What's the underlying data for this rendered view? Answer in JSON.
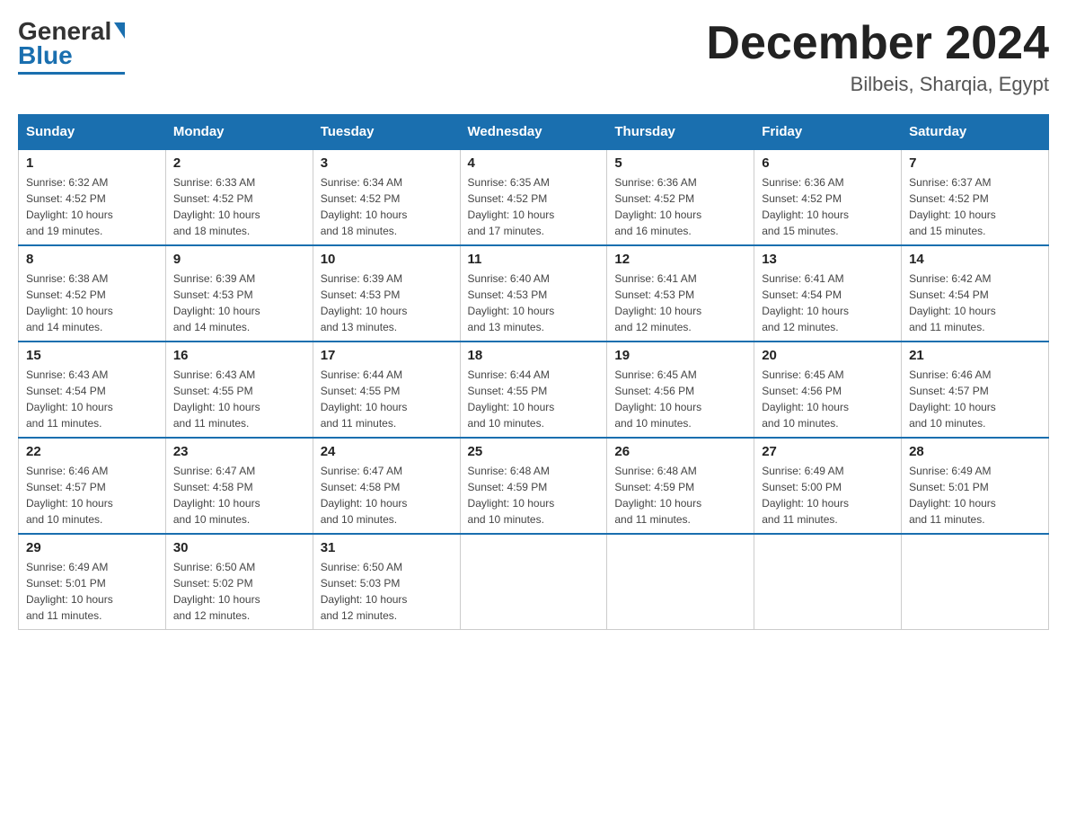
{
  "header": {
    "logo_general": "General",
    "logo_blue": "Blue",
    "month_title": "December 2024",
    "location": "Bilbeis, Sharqia, Egypt"
  },
  "days_of_week": [
    "Sunday",
    "Monday",
    "Tuesday",
    "Wednesday",
    "Thursday",
    "Friday",
    "Saturday"
  ],
  "weeks": [
    [
      {
        "num": "1",
        "sunrise": "6:32 AM",
        "sunset": "4:52 PM",
        "daylight": "10 hours and 19 minutes."
      },
      {
        "num": "2",
        "sunrise": "6:33 AM",
        "sunset": "4:52 PM",
        "daylight": "10 hours and 18 minutes."
      },
      {
        "num": "3",
        "sunrise": "6:34 AM",
        "sunset": "4:52 PM",
        "daylight": "10 hours and 18 minutes."
      },
      {
        "num": "4",
        "sunrise": "6:35 AM",
        "sunset": "4:52 PM",
        "daylight": "10 hours and 17 minutes."
      },
      {
        "num": "5",
        "sunrise": "6:36 AM",
        "sunset": "4:52 PM",
        "daylight": "10 hours and 16 minutes."
      },
      {
        "num": "6",
        "sunrise": "6:36 AM",
        "sunset": "4:52 PM",
        "daylight": "10 hours and 15 minutes."
      },
      {
        "num": "7",
        "sunrise": "6:37 AM",
        "sunset": "4:52 PM",
        "daylight": "10 hours and 15 minutes."
      }
    ],
    [
      {
        "num": "8",
        "sunrise": "6:38 AM",
        "sunset": "4:52 PM",
        "daylight": "10 hours and 14 minutes."
      },
      {
        "num": "9",
        "sunrise": "6:39 AM",
        "sunset": "4:53 PM",
        "daylight": "10 hours and 14 minutes."
      },
      {
        "num": "10",
        "sunrise": "6:39 AM",
        "sunset": "4:53 PM",
        "daylight": "10 hours and 13 minutes."
      },
      {
        "num": "11",
        "sunrise": "6:40 AM",
        "sunset": "4:53 PM",
        "daylight": "10 hours and 13 minutes."
      },
      {
        "num": "12",
        "sunrise": "6:41 AM",
        "sunset": "4:53 PM",
        "daylight": "10 hours and 12 minutes."
      },
      {
        "num": "13",
        "sunrise": "6:41 AM",
        "sunset": "4:54 PM",
        "daylight": "10 hours and 12 minutes."
      },
      {
        "num": "14",
        "sunrise": "6:42 AM",
        "sunset": "4:54 PM",
        "daylight": "10 hours and 11 minutes."
      }
    ],
    [
      {
        "num": "15",
        "sunrise": "6:43 AM",
        "sunset": "4:54 PM",
        "daylight": "10 hours and 11 minutes."
      },
      {
        "num": "16",
        "sunrise": "6:43 AM",
        "sunset": "4:55 PM",
        "daylight": "10 hours and 11 minutes."
      },
      {
        "num": "17",
        "sunrise": "6:44 AM",
        "sunset": "4:55 PM",
        "daylight": "10 hours and 11 minutes."
      },
      {
        "num": "18",
        "sunrise": "6:44 AM",
        "sunset": "4:55 PM",
        "daylight": "10 hours and 10 minutes."
      },
      {
        "num": "19",
        "sunrise": "6:45 AM",
        "sunset": "4:56 PM",
        "daylight": "10 hours and 10 minutes."
      },
      {
        "num": "20",
        "sunrise": "6:45 AM",
        "sunset": "4:56 PM",
        "daylight": "10 hours and 10 minutes."
      },
      {
        "num": "21",
        "sunrise": "6:46 AM",
        "sunset": "4:57 PM",
        "daylight": "10 hours and 10 minutes."
      }
    ],
    [
      {
        "num": "22",
        "sunrise": "6:46 AM",
        "sunset": "4:57 PM",
        "daylight": "10 hours and 10 minutes."
      },
      {
        "num": "23",
        "sunrise": "6:47 AM",
        "sunset": "4:58 PM",
        "daylight": "10 hours and 10 minutes."
      },
      {
        "num": "24",
        "sunrise": "6:47 AM",
        "sunset": "4:58 PM",
        "daylight": "10 hours and 10 minutes."
      },
      {
        "num": "25",
        "sunrise": "6:48 AM",
        "sunset": "4:59 PM",
        "daylight": "10 hours and 10 minutes."
      },
      {
        "num": "26",
        "sunrise": "6:48 AM",
        "sunset": "4:59 PM",
        "daylight": "10 hours and 11 minutes."
      },
      {
        "num": "27",
        "sunrise": "6:49 AM",
        "sunset": "5:00 PM",
        "daylight": "10 hours and 11 minutes."
      },
      {
        "num": "28",
        "sunrise": "6:49 AM",
        "sunset": "5:01 PM",
        "daylight": "10 hours and 11 minutes."
      }
    ],
    [
      {
        "num": "29",
        "sunrise": "6:49 AM",
        "sunset": "5:01 PM",
        "daylight": "10 hours and 11 minutes."
      },
      {
        "num": "30",
        "sunrise": "6:50 AM",
        "sunset": "5:02 PM",
        "daylight": "10 hours and 12 minutes."
      },
      {
        "num": "31",
        "sunrise": "6:50 AM",
        "sunset": "5:03 PM",
        "daylight": "10 hours and 12 minutes."
      },
      null,
      null,
      null,
      null
    ]
  ],
  "labels": {
    "sunrise": "Sunrise:",
    "sunset": "Sunset:",
    "daylight": "Daylight:"
  }
}
